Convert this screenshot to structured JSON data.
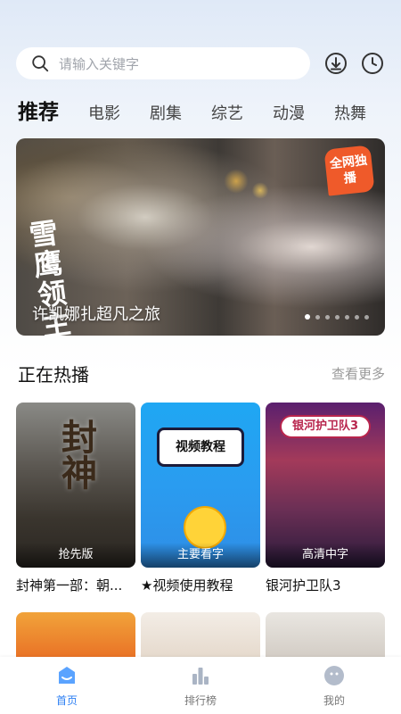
{
  "search": {
    "placeholder": "请输入关键字"
  },
  "header_icons": [
    "download-icon",
    "history-icon"
  ],
  "tabs": [
    {
      "label": "推荐",
      "active": true
    },
    {
      "label": "电影"
    },
    {
      "label": "剧集"
    },
    {
      "label": "综艺"
    },
    {
      "label": "动漫"
    },
    {
      "label": "热舞"
    }
  ],
  "banner": {
    "calligraphy": "雪鹰领主",
    "badge": "全网独播",
    "title": "许凯娜扎超凡之旅",
    "dot_count": 7,
    "active_dot": 0
  },
  "section": {
    "title": "正在热播",
    "more": "查看更多"
  },
  "cards": [
    {
      "tag": "抢先版",
      "title": "封神第一部：朝...",
      "poster_text": "封神"
    },
    {
      "tag": "主要看字",
      "title": "★视频使用教程",
      "poster_text": "视频教程"
    },
    {
      "tag": "高清中字",
      "title": "银河护卫队3",
      "poster_text": "银河护卫队3"
    }
  ],
  "bottom_nav": [
    {
      "label": "首页",
      "icon": "home-icon",
      "active": true
    },
    {
      "label": "排行榜",
      "icon": "chart-icon"
    },
    {
      "label": "我的",
      "icon": "profile-icon"
    }
  ],
  "colors": {
    "accent": "#2d7ff3",
    "badge": "#ef5a2a"
  }
}
